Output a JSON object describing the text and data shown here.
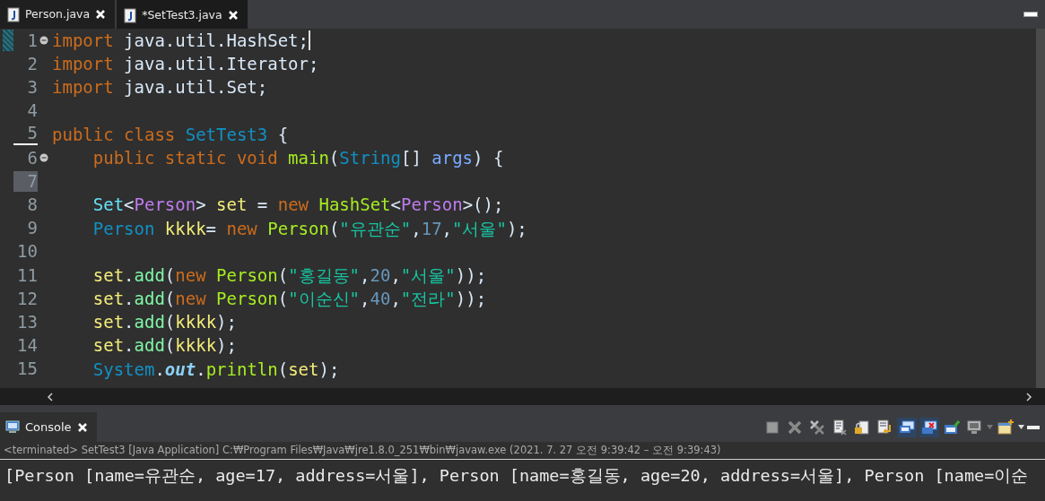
{
  "editor_tabs": [
    {
      "label": "Person.java",
      "selected": false
    },
    {
      "label": "*SetTest3.java",
      "selected": true
    }
  ],
  "code_lines": [
    {
      "number": "1",
      "fold_marker": true,
      "caret": true,
      "bookmark": true,
      "tokens": [
        {
          "kind": "keyword",
          "text": "import"
        },
        {
          "kind": "plain",
          "text": " java.util.HashSet;"
        }
      ]
    },
    {
      "number": "2",
      "tokens": [
        {
          "kind": "keyword",
          "text": "import"
        },
        {
          "kind": "plain",
          "text": " java.util.Iterator;"
        }
      ]
    },
    {
      "number": "3",
      "tokens": [
        {
          "kind": "keyword",
          "text": "import"
        },
        {
          "kind": "plain",
          "text": " java.util.Set;"
        }
      ]
    },
    {
      "number": "4"
    },
    {
      "number": "5",
      "underlined": true,
      "tokens": [
        {
          "kind": "keyword",
          "text": "public class"
        },
        {
          "kind": "type",
          "text": " SetTest3"
        },
        {
          "kind": "plain",
          "text": " {"
        }
      ]
    },
    {
      "number": "6",
      "fold_marker": true,
      "indented": true,
      "tokens": [
        {
          "kind": "keyword",
          "text": "public static void"
        },
        {
          "kind": "method",
          "text": " main"
        },
        {
          "kind": "plain",
          "text": "("
        },
        {
          "kind": "type",
          "text": "String"
        },
        {
          "kind": "plain",
          "text": "[]"
        },
        {
          "kind": "param",
          "text": " args"
        },
        {
          "kind": "plain",
          "text": ") {"
        }
      ]
    },
    {
      "number": "7",
      "highlighted": true
    },
    {
      "number": "8",
      "indented": true,
      "tokens": [
        {
          "kind": "interface",
          "text": "Set"
        },
        {
          "kind": "plain",
          "text": "<"
        },
        {
          "kind": "generic",
          "text": "Person"
        },
        {
          "kind": "plain",
          "text": ">"
        },
        {
          "kind": "variable",
          "text": " set"
        },
        {
          "kind": "plain",
          "text": " ="
        },
        {
          "kind": "keyword",
          "text": " new"
        },
        {
          "kind": "method",
          "text": " HashSet"
        },
        {
          "kind": "plain",
          "text": "<"
        },
        {
          "kind": "generic",
          "text": "Person"
        },
        {
          "kind": "plain",
          "text": ">();"
        }
      ]
    },
    {
      "number": "9",
      "indented": true,
      "tokens": [
        {
          "kind": "type",
          "text": "Person"
        },
        {
          "kind": "variable",
          "text": " kkkk"
        },
        {
          "kind": "plain",
          "text": "="
        },
        {
          "kind": "keyword",
          "text": " new"
        },
        {
          "kind": "method",
          "text": " Person"
        },
        {
          "kind": "plain",
          "text": "("
        },
        {
          "kind": "string",
          "text": "\"유관순\""
        },
        {
          "kind": "plain",
          "text": ","
        },
        {
          "kind": "number",
          "text": "17"
        },
        {
          "kind": "plain",
          "text": ","
        },
        {
          "kind": "string",
          "text": "\"서울\""
        },
        {
          "kind": "plain",
          "text": ");"
        }
      ]
    },
    {
      "number": "10"
    },
    {
      "number": "11",
      "indented": true,
      "tokens": [
        {
          "kind": "variable",
          "text": "set"
        },
        {
          "kind": "plain",
          "text": "."
        },
        {
          "kind": "call",
          "text": "add"
        },
        {
          "kind": "plain",
          "text": "("
        },
        {
          "kind": "keyword",
          "text": "new"
        },
        {
          "kind": "method",
          "text": " Person"
        },
        {
          "kind": "plain",
          "text": "("
        },
        {
          "kind": "string",
          "text": "\"홍길동\""
        },
        {
          "kind": "plain",
          "text": ","
        },
        {
          "kind": "number",
          "text": "20"
        },
        {
          "kind": "plain",
          "text": ","
        },
        {
          "kind": "string",
          "text": "\"서울\""
        },
        {
          "kind": "plain",
          "text": "));"
        }
      ]
    },
    {
      "number": "12",
      "indented": true,
      "tokens": [
        {
          "kind": "variable",
          "text": "set"
        },
        {
          "kind": "plain",
          "text": "."
        },
        {
          "kind": "call",
          "text": "add"
        },
        {
          "kind": "plain",
          "text": "("
        },
        {
          "kind": "keyword",
          "text": "new"
        },
        {
          "kind": "method",
          "text": " Person"
        },
        {
          "kind": "plain",
          "text": "("
        },
        {
          "kind": "string",
          "text": "\"이순신\""
        },
        {
          "kind": "plain",
          "text": ","
        },
        {
          "kind": "number",
          "text": "40"
        },
        {
          "kind": "plain",
          "text": ","
        },
        {
          "kind": "string",
          "text": "\"전라\""
        },
        {
          "kind": "plain",
          "text": "));"
        }
      ]
    },
    {
      "number": "13",
      "indented": true,
      "tokens": [
        {
          "kind": "variable",
          "text": "set"
        },
        {
          "kind": "plain",
          "text": "."
        },
        {
          "kind": "call",
          "text": "add"
        },
        {
          "kind": "plain",
          "text": "("
        },
        {
          "kind": "variable",
          "text": "kkkk"
        },
        {
          "kind": "plain",
          "text": ");"
        }
      ]
    },
    {
      "number": "14",
      "indented": true,
      "tokens": [
        {
          "kind": "variable",
          "text": "set"
        },
        {
          "kind": "plain",
          "text": "."
        },
        {
          "kind": "call",
          "text": "add"
        },
        {
          "kind": "plain",
          "text": "("
        },
        {
          "kind": "variable",
          "text": "kkkk"
        },
        {
          "kind": "plain",
          "text": ");"
        }
      ]
    },
    {
      "number": "15",
      "indented": true,
      "tokens": [
        {
          "kind": "type",
          "text": "System"
        },
        {
          "kind": "plain",
          "text": "."
        },
        {
          "kind": "field",
          "text": "out"
        },
        {
          "kind": "plain",
          "text": "."
        },
        {
          "kind": "method",
          "text": "println"
        },
        {
          "kind": "plain",
          "text": "("
        },
        {
          "kind": "variable",
          "text": "set"
        },
        {
          "kind": "plain",
          "text": ");"
        }
      ]
    }
  ],
  "console": {
    "tab_label": "Console",
    "toolbar": [
      {
        "kind": "square",
        "pressed": false
      },
      {
        "kind": "cross",
        "pressed": false
      },
      {
        "kind": "double-cross",
        "pressed": false
      },
      {
        "kind": "document",
        "pressed": false
      },
      {
        "kind": "lock",
        "pressed": false
      },
      {
        "kind": "wrap",
        "pressed": false
      },
      {
        "kind": "monitor",
        "pressed": true
      },
      {
        "kind": "monitor-error",
        "pressed": true
      },
      {
        "kind": "pin",
        "pressed": false
      },
      {
        "kind": "display",
        "pressed": false
      },
      {
        "kind": "new-window",
        "pressed": false
      }
    ],
    "header": "<terminated> SetTest3 [Java Application] C:₩Program Files₩Java₩jre1.8.0_251₩bin₩javaw.exe  (2021. 7. 27 오전 9:39:42 – 오전 9:39:43)",
    "output": "[Person [name=유관순, age=17, address=서울], Person [name=홍길동, age=20, address=서울], Person [name=이순"
  }
}
